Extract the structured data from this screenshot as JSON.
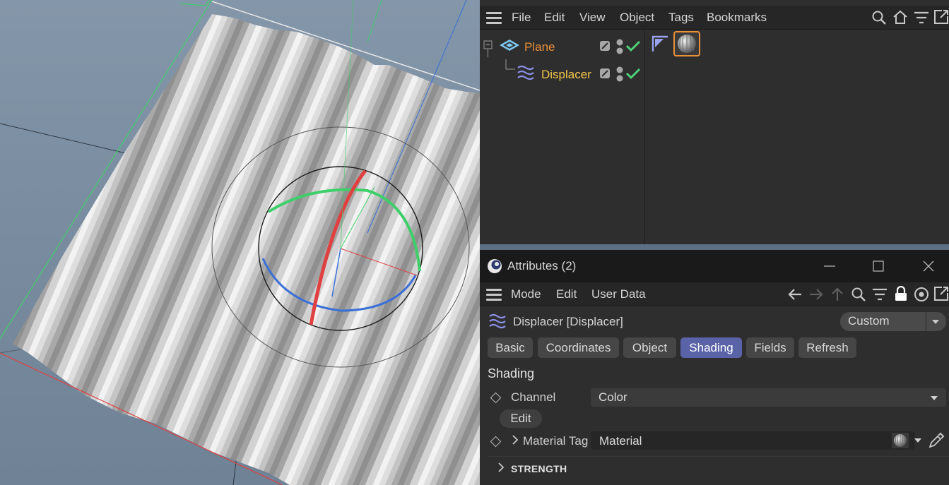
{
  "object_manager": {
    "menu": [
      "File",
      "Edit",
      "View",
      "Object",
      "Tags",
      "Bookmarks"
    ],
    "toolbar_icons": [
      "search-icon",
      "home-icon",
      "filter-icon",
      "new-window-icon"
    ],
    "objects": [
      {
        "name": "Plane",
        "color": "#e8903a",
        "icon": "plane-icon",
        "checked": true
      },
      {
        "name": "Displacer",
        "color": "#f5c84a",
        "icon": "displacer-icon",
        "checked": true
      }
    ],
    "tags": [
      "phong-tag-icon",
      "material-tag-icon"
    ]
  },
  "attributes": {
    "window_title": "Attributes (2)",
    "window_controls": [
      "minimize-icon",
      "maximize-icon",
      "close-icon"
    ],
    "menu": [
      "Mode",
      "Edit",
      "User Data"
    ],
    "toolbar_icons": [
      "back-arrow-icon",
      "forward-arrow-icon",
      "up-arrow-icon",
      "search-icon",
      "filter-icon",
      "lock-icon",
      "target-icon",
      "new-window-icon"
    ],
    "object_label": "Displacer [Displacer]",
    "preset": "Custom",
    "tabs": [
      "Basic",
      "Coordinates",
      "Object",
      "Shading",
      "Fields",
      "Refresh"
    ],
    "active_tab": "Shading",
    "section_title": "Shading",
    "channel_label": "Channel",
    "channel_value": "Color",
    "edit_button": "Edit",
    "material_tag_label": "Material Tag",
    "material_tag_value": "Material",
    "strength_label": "STRENGTH"
  },
  "colors": {
    "accent_tab": "#5a62a8",
    "check": "#4fd67a",
    "selected_tag_border": "#e8903a",
    "axis_x": "#e04040",
    "axis_y": "#3fcf6a",
    "axis_z": "#3a6fd8"
  }
}
